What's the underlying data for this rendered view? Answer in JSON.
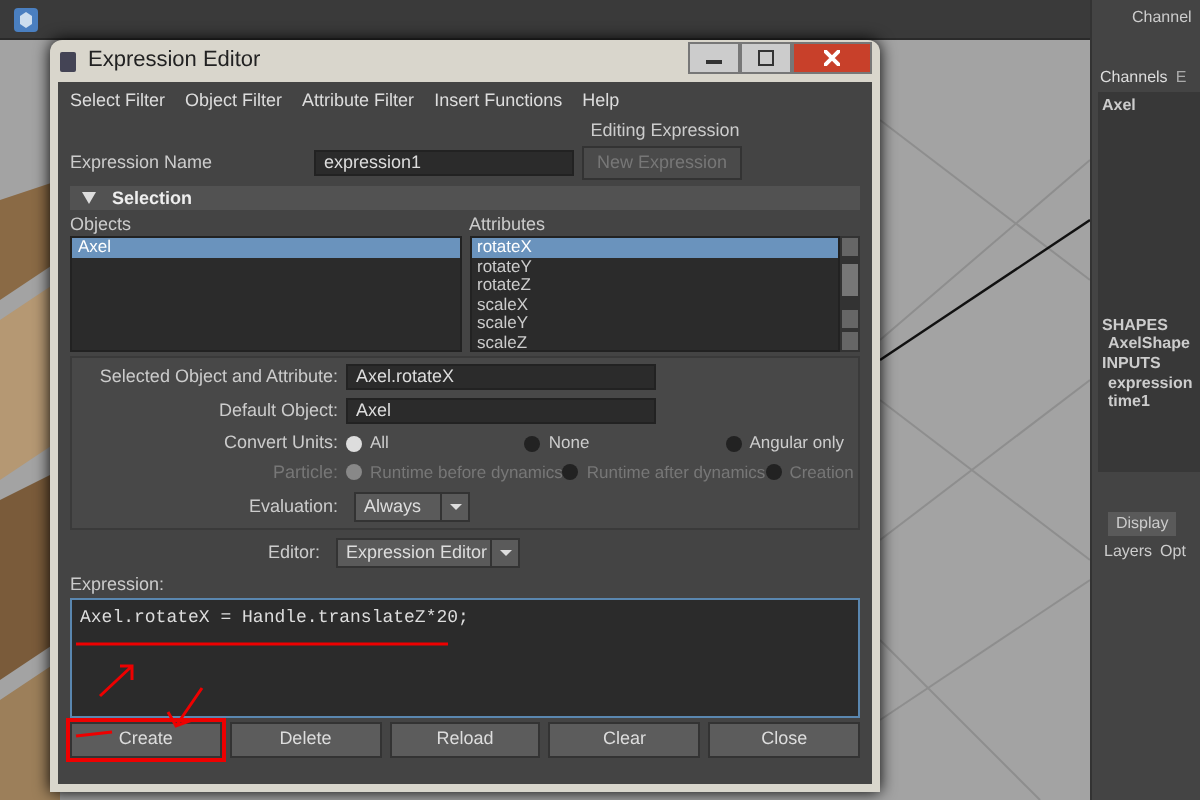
{
  "window": {
    "title": "Expression Editor"
  },
  "menu": [
    "Select Filter",
    "Object Filter",
    "Attribute Filter",
    "Insert Functions",
    "Help"
  ],
  "heading": "Editing Expression",
  "expression_name": {
    "label": "Expression Name",
    "value": "expression1"
  },
  "new_button": {
    "label": "New Expression",
    "disabled": true
  },
  "selection": {
    "title": "Selection",
    "expanded": true,
    "objects": {
      "header": "Objects",
      "items": [
        {
          "label": "Axel",
          "selected": true
        }
      ]
    },
    "attributes": {
      "header": "Attributes",
      "items": [
        {
          "label": "rotateX",
          "selected": true
        },
        {
          "label": "rotateY",
          "selected": false
        },
        {
          "label": "rotateZ",
          "selected": false
        },
        {
          "label": "scaleX",
          "selected": false
        },
        {
          "label": "scaleY",
          "selected": false
        },
        {
          "label": "scaleZ",
          "selected": false
        }
      ]
    }
  },
  "fields": [
    {
      "label": "Selected Object and Attribute:",
      "value": "Axel.rotateX"
    },
    {
      "label": "Default Object:",
      "value": "Axel"
    }
  ],
  "radio_groups": [
    {
      "label": "Convert Units:",
      "disabled": false,
      "options": [
        {
          "label": "All",
          "selected": true
        },
        {
          "label": "None",
          "selected": false
        },
        {
          "label": "Angular only",
          "selected": false
        }
      ]
    },
    {
      "label": "Particle:",
      "disabled": true,
      "options": [
        {
          "label": "Runtime before dynamics",
          "selected": true
        },
        {
          "label": "Runtime after dynamics",
          "selected": false
        },
        {
          "label": "Creation",
          "selected": false
        }
      ]
    }
  ],
  "evaluation": {
    "label": "Evaluation:",
    "value": "Always"
  },
  "editor": {
    "label": "Editor:",
    "value": "Expression Editor"
  },
  "expression": {
    "label": "Expression:",
    "value": "Axel.rotateX = Handle.translateZ*20;"
  },
  "buttons": [
    {
      "label": "Create",
      "highlighted": true
    },
    {
      "label": "Delete",
      "highlighted": false
    },
    {
      "label": "Reload",
      "highlighted": false
    },
    {
      "label": "Clear",
      "highlighted": false
    },
    {
      "label": "Close",
      "highlighted": false
    }
  ],
  "channel_box": {
    "title": "Channel",
    "tabs": [
      {
        "label": "Channels",
        "selected": true
      },
      {
        "label": "E",
        "selected": false
      }
    ],
    "object": "Axel",
    "sections": [
      {
        "header": "SHAPES",
        "items": [
          "AxelShape"
        ]
      },
      {
        "header": "INPUTS",
        "items": [
          "expression",
          "time1"
        ]
      }
    ],
    "bottom_tabs": [
      {
        "label": "Display",
        "selected": true
      }
    ],
    "bottom_menu": [
      "Layers",
      "Opt"
    ]
  }
}
